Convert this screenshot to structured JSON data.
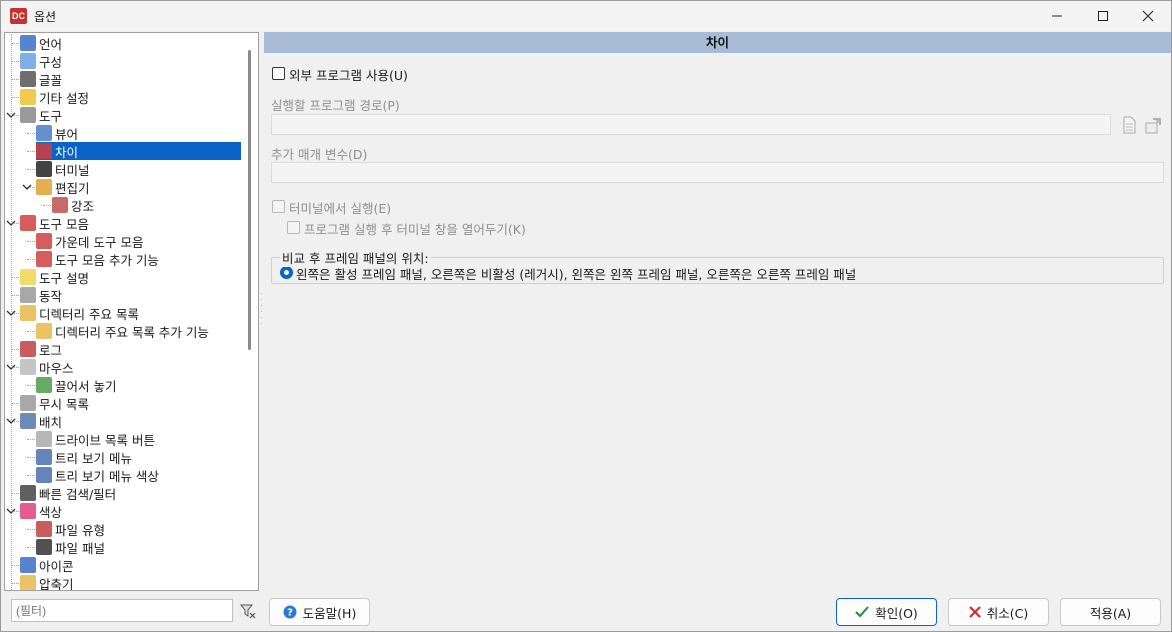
{
  "window": {
    "title": "옵션",
    "app_icon_label": "DC",
    "controls": [
      "minimize-icon",
      "maximize-icon",
      "close-icon"
    ]
  },
  "tree": {
    "items": [
      {
        "label": "언어",
        "icon": "flag-icon",
        "color": "#3a6fc4"
      },
      {
        "label": "구성",
        "icon": "config-icon",
        "color": "#6aa0e0"
      },
      {
        "label": "글꼴",
        "icon": "font-icon",
        "color": "#555555"
      },
      {
        "label": "기타 설정",
        "icon": "smiley-icon",
        "color": "#f2c12e"
      },
      {
        "label": "도구",
        "icon": "tools-icon",
        "color": "#888888"
      },
      {
        "label": "뷰어",
        "icon": "book-icon",
        "color": "#4a7cc7"
      },
      {
        "label": "차이",
        "icon": "diff-icon",
        "color": "#d33c3c"
      },
      {
        "label": "터미널",
        "icon": "terminal-icon",
        "color": "#222222"
      },
      {
        "label": "편집기",
        "icon": "editor-icon",
        "color": "#e0a030"
      },
      {
        "label": "강조",
        "icon": "highlight-icon",
        "color": "#c0504d"
      },
      {
        "label": "도구 모음",
        "icon": "toolbar-icon",
        "color": "#d04040"
      },
      {
        "label": "가운데 도구 모음",
        "icon": "toolbar-icon",
        "color": "#d04040"
      },
      {
        "label": "도구 모음 추가 기능",
        "icon": "toolbar-icon",
        "color": "#d04040"
      },
      {
        "label": "도구 설명",
        "icon": "lightbulb-icon",
        "color": "#f2d44e"
      },
      {
        "label": "동작",
        "icon": "behavior-icon",
        "color": "#999999"
      },
      {
        "label": "디렉터리 주요 목록",
        "icon": "folder-icon",
        "color": "#e8b84a"
      },
      {
        "label": "디렉터리 주요 목록 추가 기능",
        "icon": "folder-icon",
        "color": "#e8b84a"
      },
      {
        "label": "로그",
        "icon": "log-icon",
        "color": "#c04040"
      },
      {
        "label": "마우스",
        "icon": "mouse-icon",
        "color": "#bbbbbb"
      },
      {
        "label": "끌어서 놓기",
        "icon": "drag-drop-icon",
        "color": "#4a9c4a"
      },
      {
        "label": "무시 목록",
        "icon": "ignore-list-icon",
        "color": "#999999"
      },
      {
        "label": "배치",
        "icon": "layout-icon",
        "color": "#5577aa"
      },
      {
        "label": "드라이브 목록 버튼",
        "icon": "drive-icon",
        "color": "#aaaaaa"
      },
      {
        "label": "트리 보기 메뉴",
        "icon": "tree-menu-icon",
        "color": "#4a6fb0"
      },
      {
        "label": "트리 보기 메뉴 색상",
        "icon": "tree-menu-icon",
        "color": "#4a6fb0"
      },
      {
        "label": "빠른 검색/필터",
        "icon": "binoculars-icon",
        "color": "#444444"
      },
      {
        "label": "색상",
        "icon": "color-wheel-icon",
        "color": "#e04080"
      },
      {
        "label": "파일 유형",
        "icon": "file-type-icon",
        "color": "#c04040"
      },
      {
        "label": "파일 패널",
        "icon": "file-panel-icon",
        "color": "#333333"
      },
      {
        "label": "아이콘",
        "icon": "footprints-icon",
        "color": "#3a6fc4"
      },
      {
        "label": "압축기",
        "icon": "archive-icon",
        "color": "#e8b84a"
      }
    ]
  },
  "filter": {
    "placeholder": "(필터)"
  },
  "panel": {
    "header": "차이",
    "use_external_label": "외부 프로그램 사용(U)",
    "path_label": "실행할 프로그램 경로(P)",
    "params_label": "추가 매개 변수(D)",
    "run_in_terminal_label": "터미널에서 실행(E)",
    "keep_terminal_label": "프로그램 실행 후 터미널 창을 열어두기(K)",
    "position_group_label": "비교 후 프레임 패널의 위치:",
    "position_option_label": "왼쪽은 활성 프레임 패널, 오른쪽은 비활성 (레거시), 왼쪽은 왼쪽 프레임 패널, 오른쪽은 오른쪽 프레임 패널"
  },
  "buttons": {
    "help": "도움말(H)",
    "ok": "확인(O)",
    "cancel": "취소(C)",
    "apply": "적용(A)"
  },
  "colors": {
    "selection": "#0a64c8",
    "header_bg": "#a8bcd6",
    "ok_icon": "#1e8e3e",
    "cancel_icon": "#d32f2f",
    "help_icon": "#2a7ad5"
  }
}
